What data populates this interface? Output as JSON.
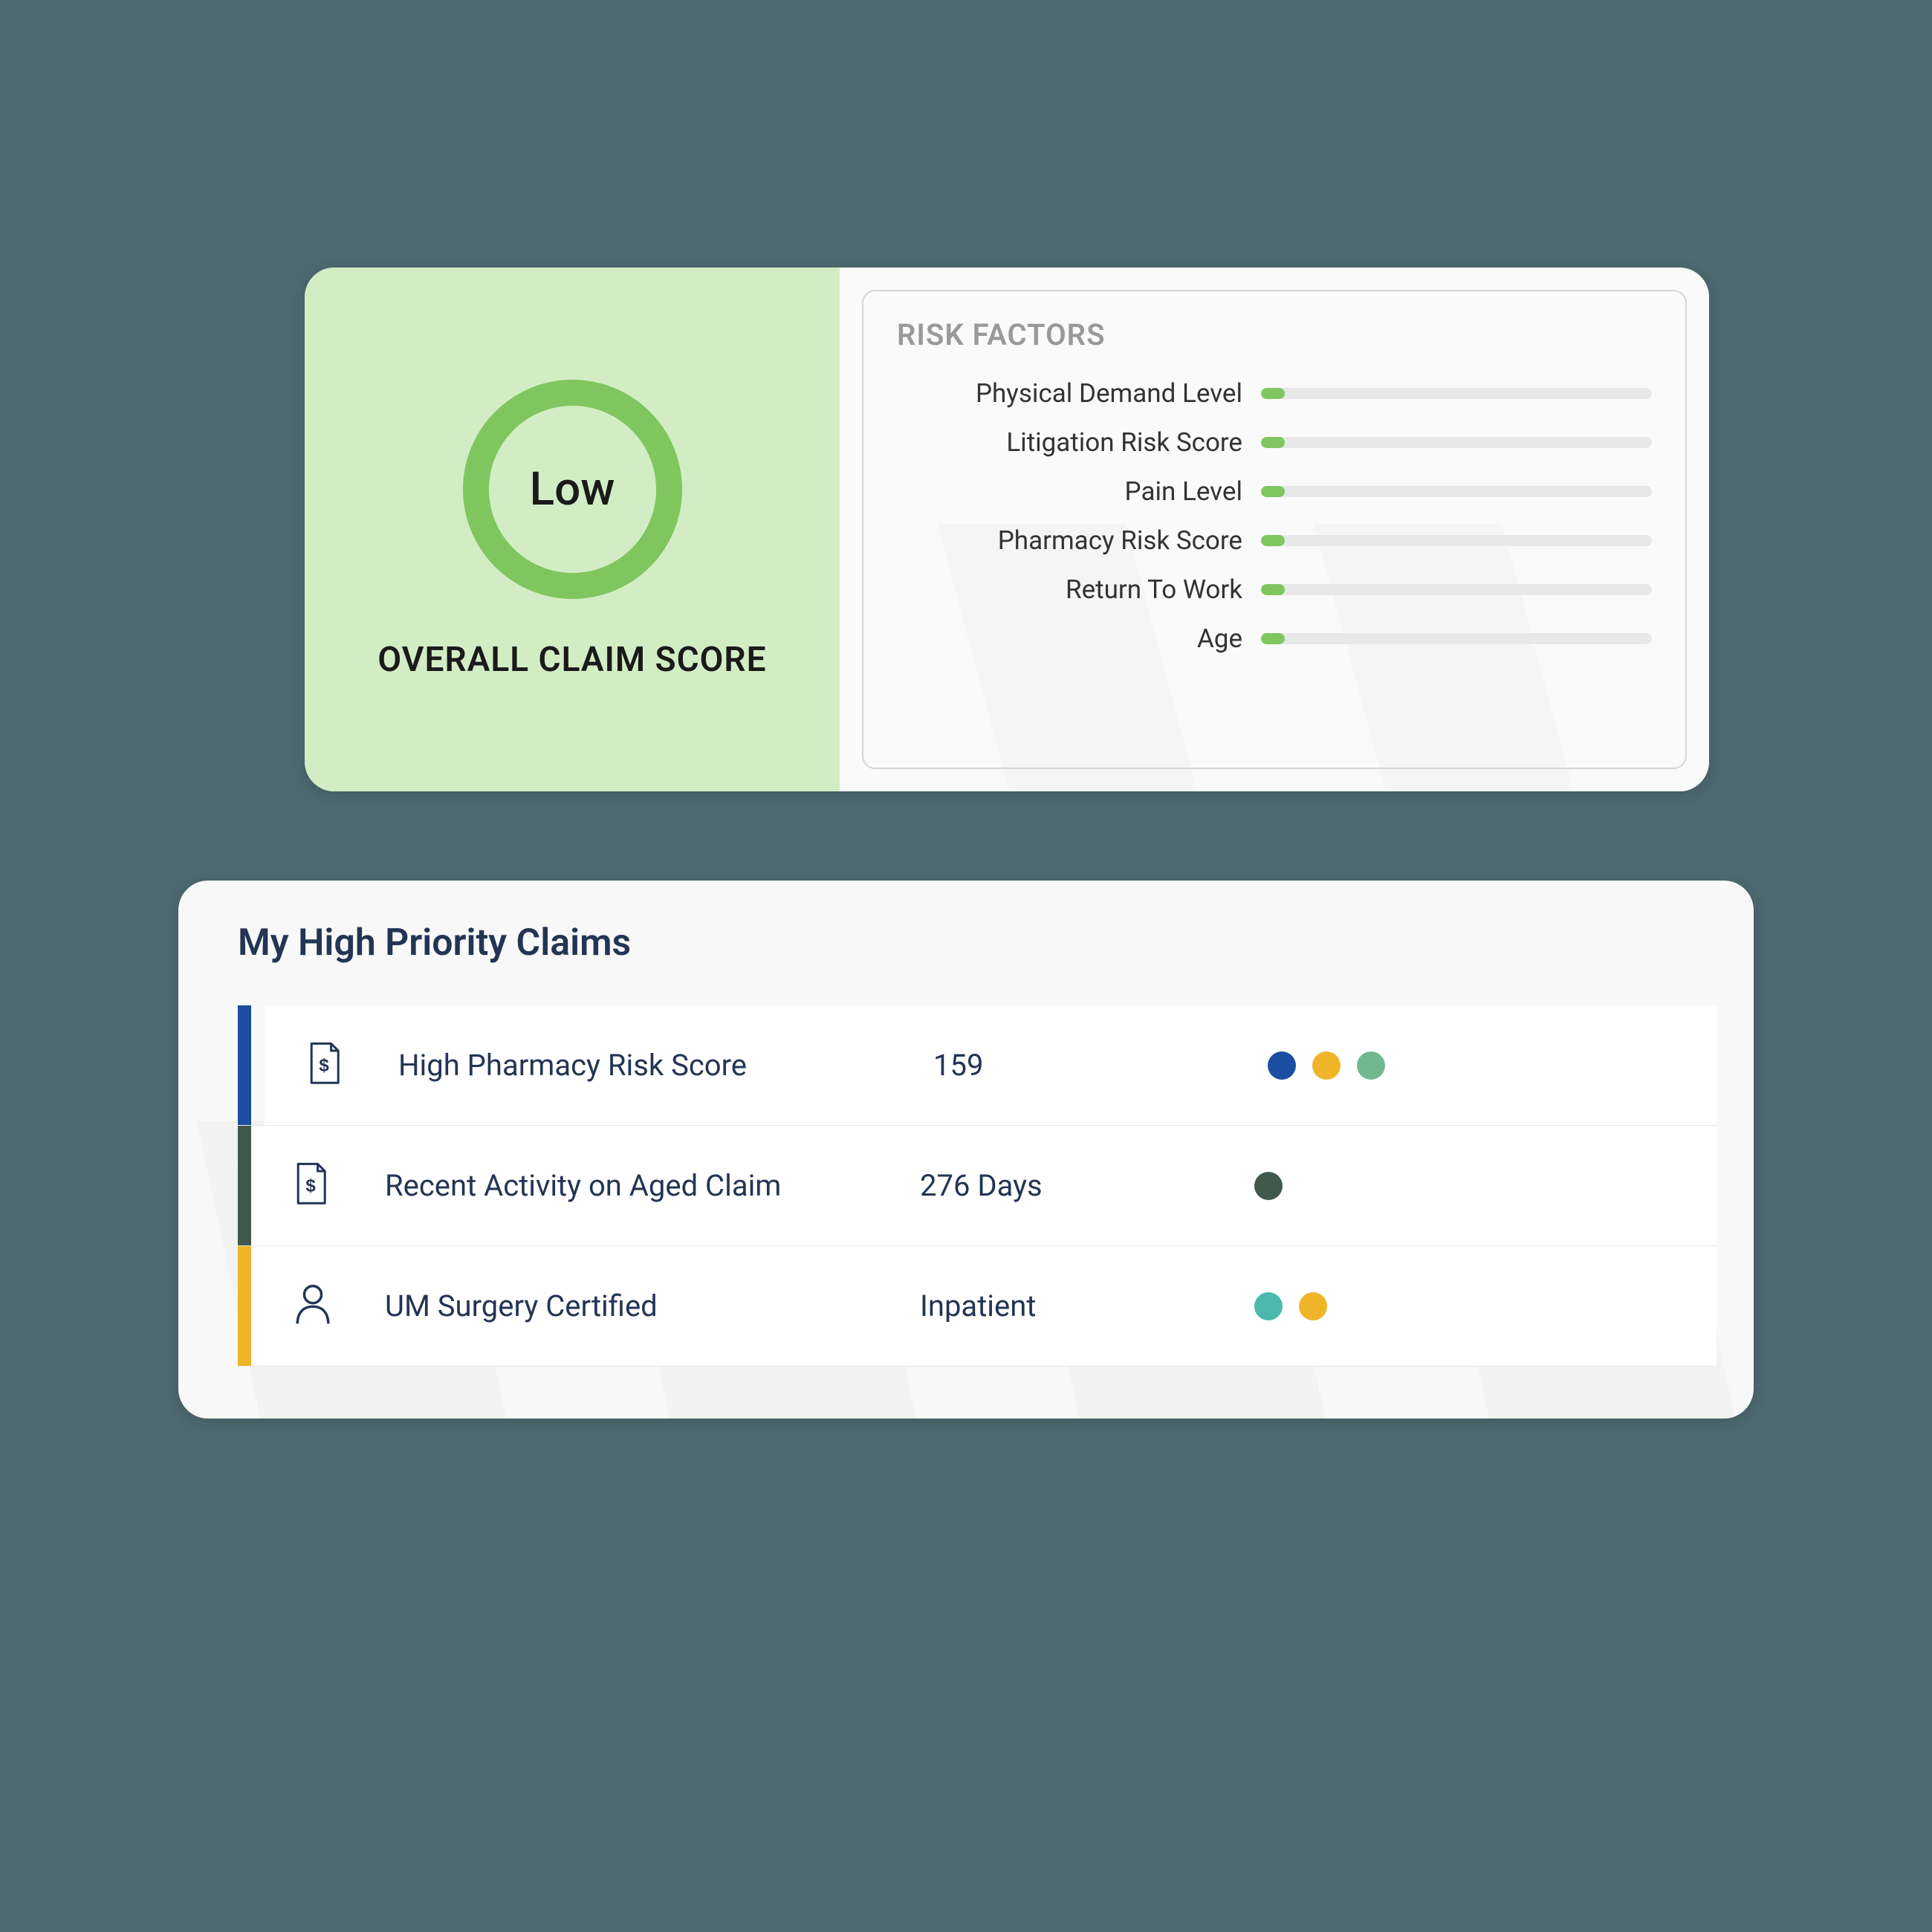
{
  "claimScore": {
    "scoreLabel": "Low",
    "overallLabel": "OVERALL CLAIM SCORE",
    "riskFactorsTitle": "RISK FACTORS",
    "factors": [
      {
        "label": "Physical Demand Level",
        "percent": 6
      },
      {
        "label": "Litigation Risk Score",
        "percent": 6
      },
      {
        "label": "Pain Level",
        "percent": 6
      },
      {
        "label": "Pharmacy Risk Score",
        "percent": 6
      },
      {
        "label": "Return To Work",
        "percent": 6
      },
      {
        "label": "Age",
        "percent": 6
      }
    ],
    "fillColor": "#80c65f"
  },
  "priorityClaims": {
    "title": "My High Priority Claims",
    "items": [
      {
        "accentColor": "#1a4ea1",
        "iconType": "document",
        "name": "High Pharmacy Risk Score",
        "value": "159",
        "dots": [
          "#1a4ea1",
          "#f0b429",
          "#71b891"
        ]
      },
      {
        "accentColor": "#3f5a4d",
        "iconType": "document",
        "name": "Recent Activity on Aged Claim",
        "value": "276 Days",
        "dots": [
          "#3f5a4d"
        ]
      },
      {
        "accentColor": "#f0b429",
        "iconType": "person",
        "name": "UM Surgery Certified",
        "value": "Inpatient",
        "dots": [
          "#4bb8ae",
          "#f0b429"
        ]
      }
    ]
  }
}
